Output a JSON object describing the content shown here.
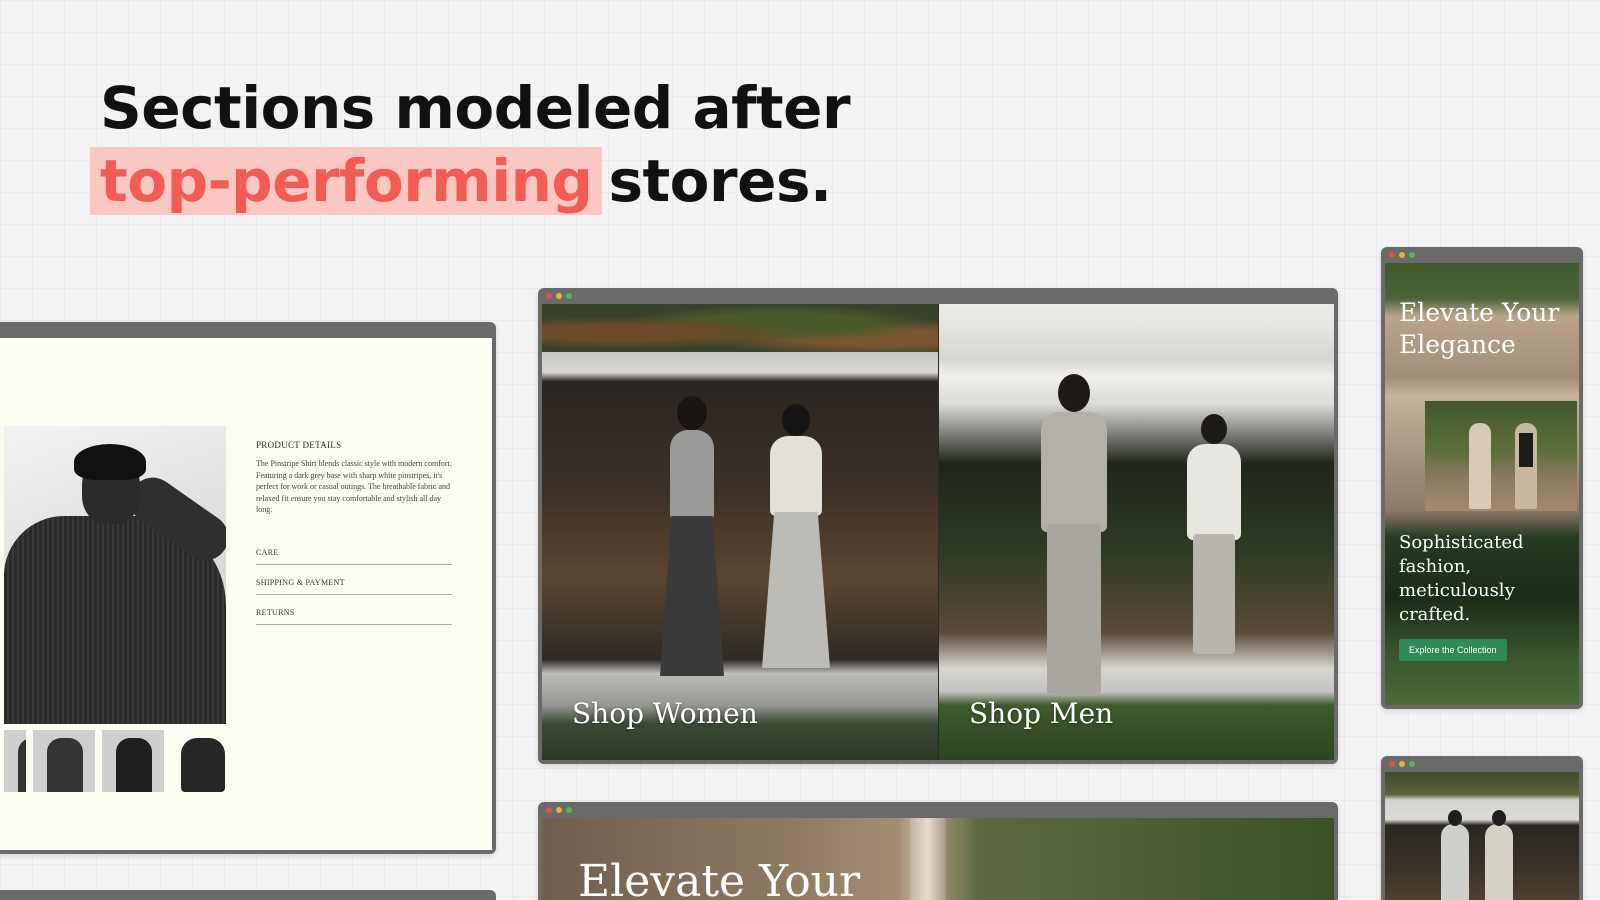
{
  "headline": {
    "line1": "Sections modeled after",
    "highlight": "top-performing",
    "line2_rest": "stores."
  },
  "colors": {
    "highlight_text": "#f25c54",
    "highlight_bg": "#fbc7c2",
    "button_green": "#2f8a55",
    "window_chrome": "#6a6a6a"
  },
  "product_window": {
    "details_title": "PRODUCT DETAILS",
    "description": "The Pinstripe Shirt blends classic style with modern comfort. Featuring a dark grey base with sharp white pinstripes, it's perfect for work or casual outings. The breathable fabric and relaxed fit ensure you stay comfortable and stylish all day long.",
    "accordion": [
      "CARE",
      "SHIPPING & PAYMENT",
      "RETURNS"
    ]
  },
  "shop_window": {
    "women_label": "Shop Women",
    "men_label": "Shop Men"
  },
  "elevate_window": {
    "title": "Elevate Your Elegance",
    "subtitle": "Sophisticated fashion, meticulously crafted.",
    "button_label": "Explore the Collection"
  },
  "bottom_window": {
    "title": "Elevate Your"
  }
}
